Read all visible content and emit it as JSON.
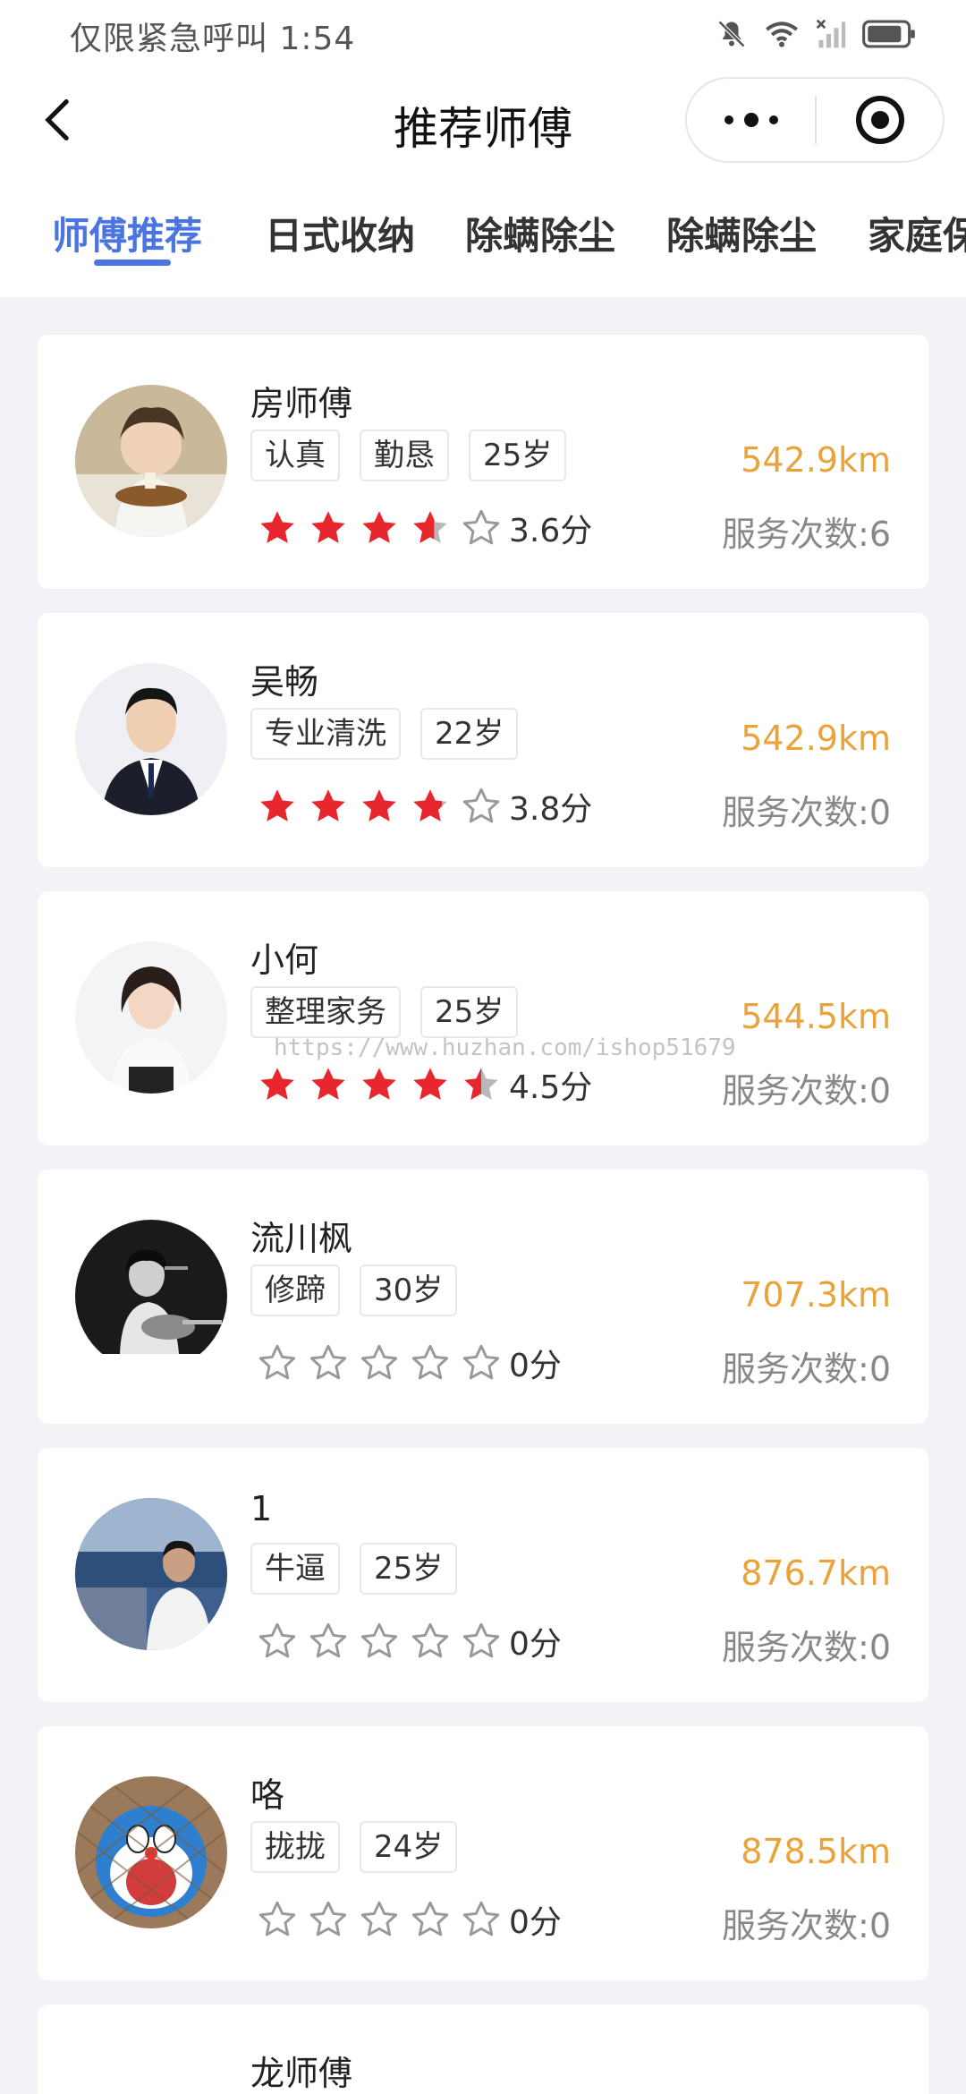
{
  "status_bar": {
    "text": "仅限紧急呼叫 1:54"
  },
  "nav": {
    "title": "推荐师傅"
  },
  "tabs": [
    {
      "label": "师傅推荐",
      "active": true
    },
    {
      "label": "日式收纳",
      "active": false
    },
    {
      "label": "除螨除尘",
      "active": false
    },
    {
      "label": "除螨除尘",
      "active": false
    },
    {
      "label": "家庭保",
      "active": false
    }
  ],
  "colors": {
    "accent": "#4a74e0",
    "distance": "#e9a33a",
    "star_filled": "#e8262d",
    "star_empty": "#999999"
  },
  "workers": [
    {
      "name": "房师傅",
      "tags": [
        "认真",
        "勤恳",
        "25岁"
      ],
      "rating": 3.6,
      "score": "3.6分",
      "distance": "542.9km",
      "service_count": "服务次数:6"
    },
    {
      "name": "吴畅",
      "tags": [
        "专业清洗",
        "22岁"
      ],
      "rating": 3.8,
      "score": "3.8分",
      "distance": "542.9km",
      "service_count": "服务次数:0"
    },
    {
      "name": "小何",
      "tags": [
        "整理家务",
        "25岁"
      ],
      "rating": 4.5,
      "score": "4.5分",
      "distance": "544.5km",
      "service_count": "服务次数:0"
    },
    {
      "name": "流川枫",
      "tags": [
        "修蹄",
        "30岁"
      ],
      "rating": 0,
      "score": "0分",
      "distance": "707.3km",
      "service_count": "服务次数:0"
    },
    {
      "name": "1",
      "tags": [
        "牛逼",
        "25岁"
      ],
      "rating": 0,
      "score": "0分",
      "distance": "876.7km",
      "service_count": "服务次数:0"
    },
    {
      "name": "咯",
      "tags": [
        "拢拢",
        "24岁"
      ],
      "rating": 0,
      "score": "0分",
      "distance": "878.5km",
      "service_count": "服务次数:0"
    },
    {
      "name": "龙师傅",
      "tags": [],
      "rating": null,
      "score": "",
      "distance": "",
      "service_count": ""
    }
  ],
  "watermark": "https://www.huzhan.com/ishop51679"
}
